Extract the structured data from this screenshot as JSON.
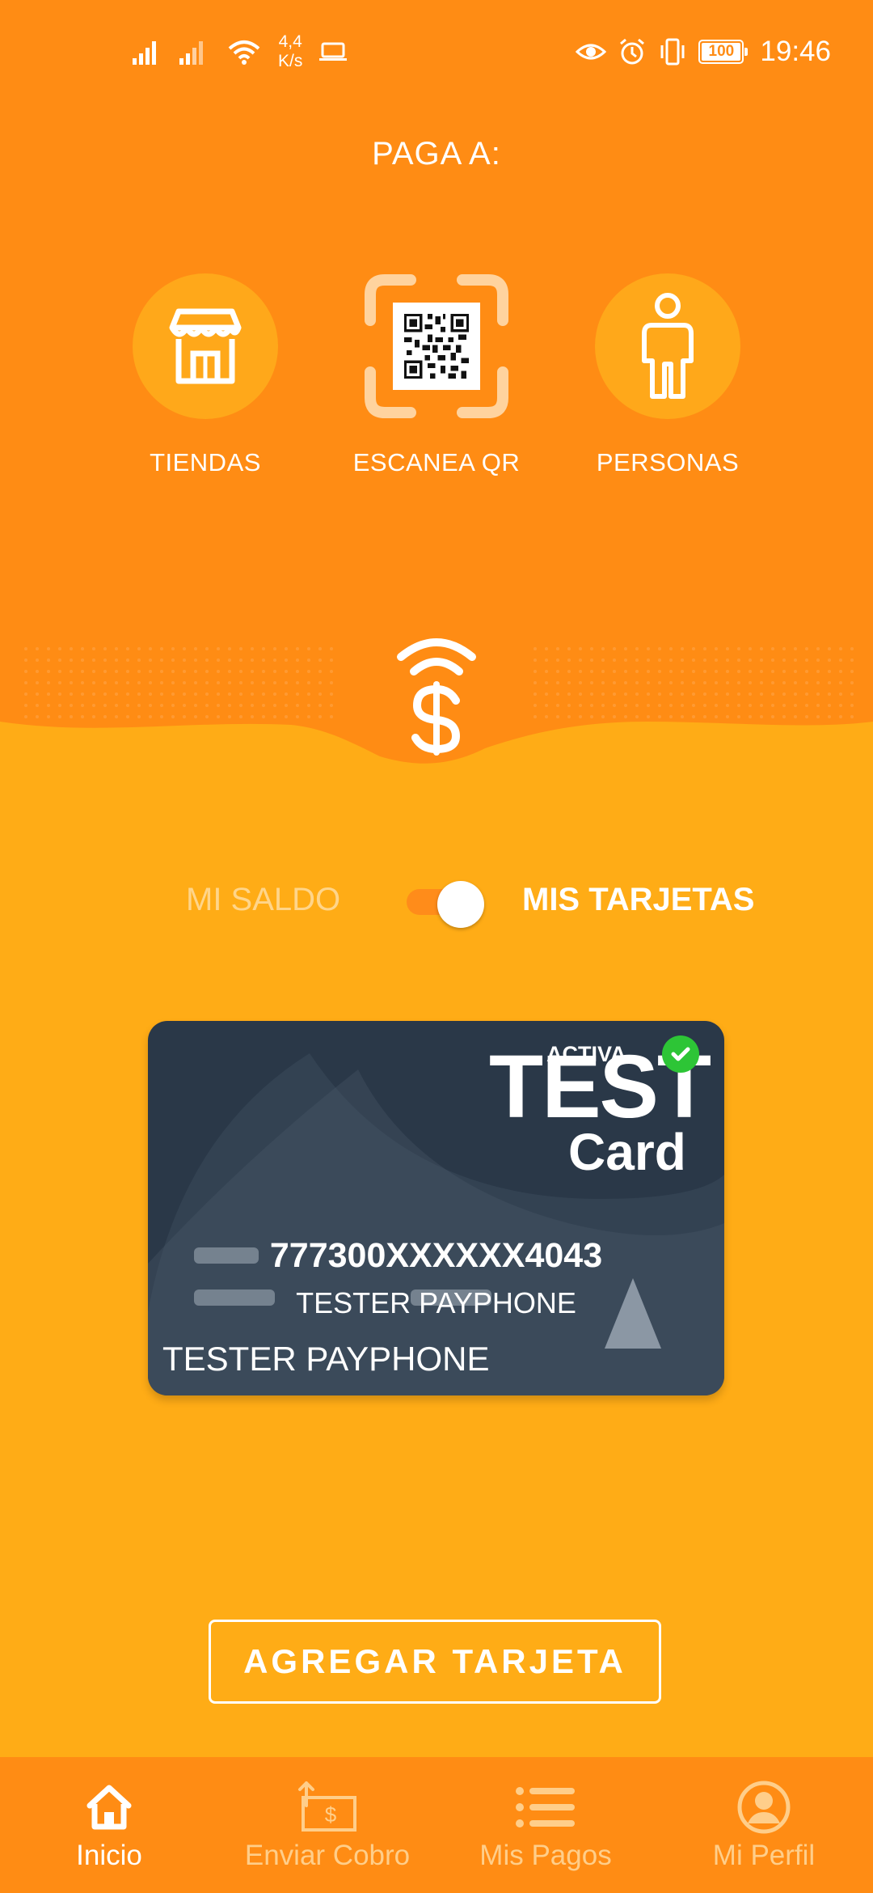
{
  "status_bar": {
    "network_speed": "4,4\nK/s",
    "speed_value": "4,4",
    "speed_unit": "K/s",
    "battery": "100",
    "time": "19:46"
  },
  "header": {
    "title": "PAGA A:",
    "options": [
      {
        "label": "TIENDAS",
        "icon": "store-icon"
      },
      {
        "label": "ESCANEA QR",
        "icon": "qr-code-icon"
      },
      {
        "label": "PERSONAS",
        "icon": "person-icon"
      }
    ]
  },
  "toggle": {
    "left_label": "MI SALDO",
    "right_label": "MIS TARJETAS",
    "selected": "MIS TARJETAS"
  },
  "card": {
    "status": "ACTIVA",
    "brand_line1": "TEST",
    "brand_line2": "Card",
    "number": "777300XXXXXX4043",
    "holder_center": "TESTER PAYPHONE",
    "holder": "TESTER PAYPHONE"
  },
  "add_button": "AGREGAR TARJETA",
  "nav": [
    {
      "label": "Inicio",
      "icon": "home-icon",
      "active": true
    },
    {
      "label": "Enviar Cobro",
      "icon": "send-charge-icon",
      "active": false
    },
    {
      "label": "Mis Pagos",
      "icon": "list-icon",
      "active": false
    },
    {
      "label": "Mi Perfil",
      "icon": "profile-icon",
      "active": false
    }
  ],
  "colors": {
    "background": "#FFAC16",
    "header": "#FF8C14",
    "card": "#2A3848",
    "check": "#2DC536"
  }
}
